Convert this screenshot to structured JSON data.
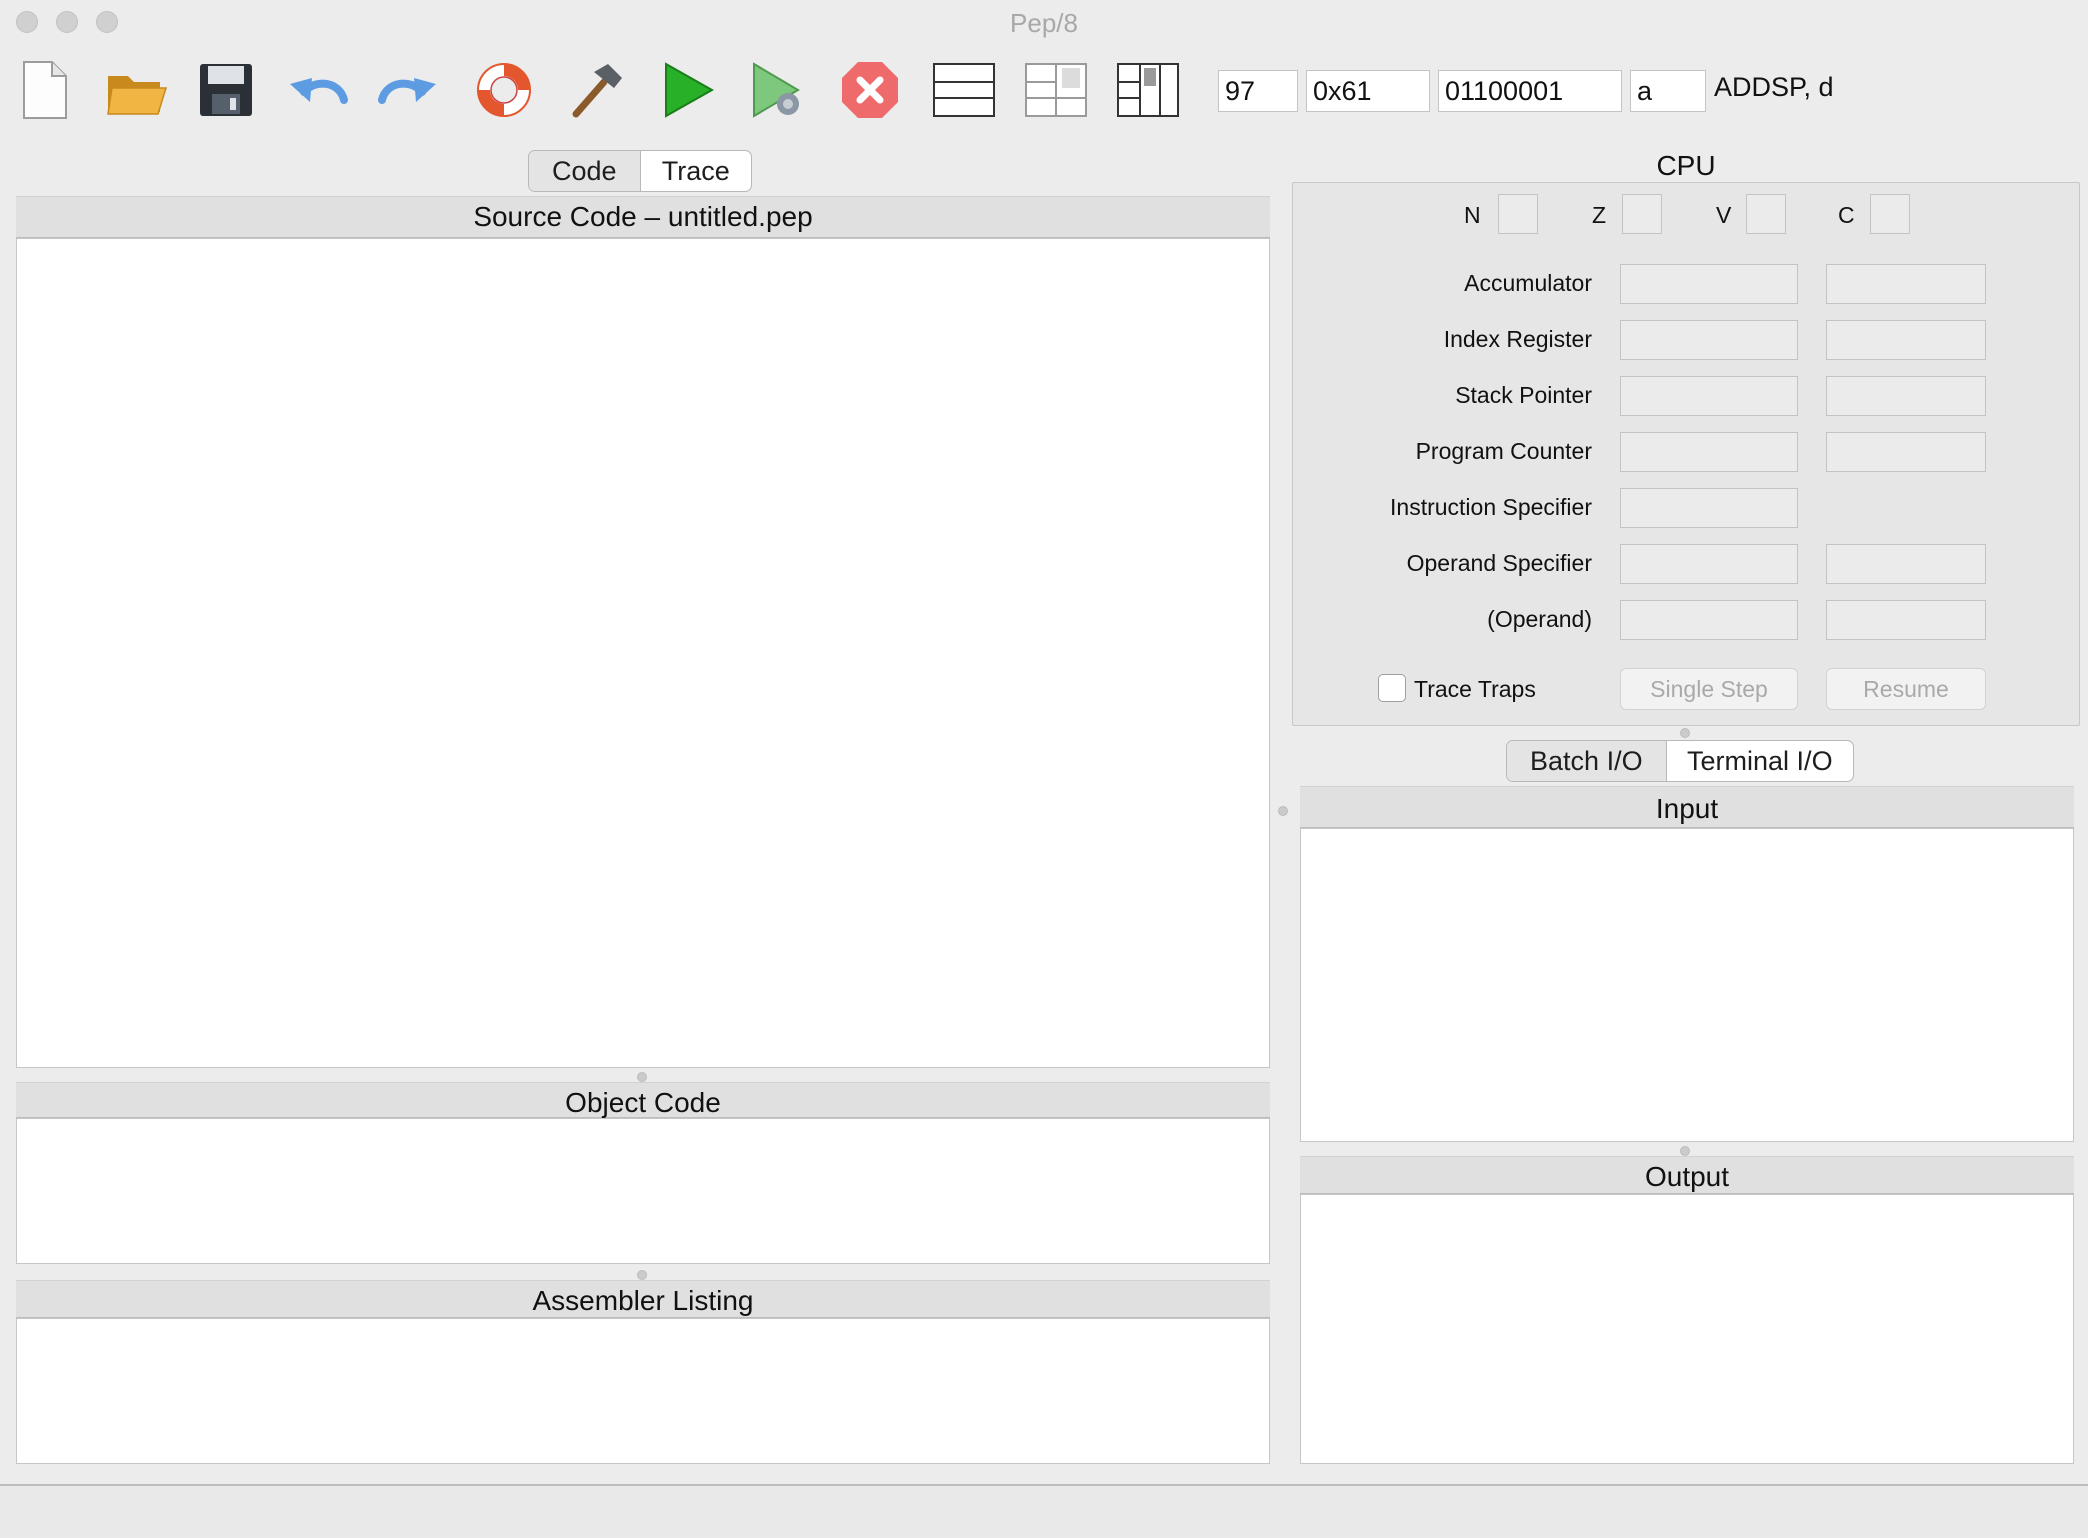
{
  "window": {
    "title": "Pep/8"
  },
  "toolbar": {
    "icons": [
      "new-file-icon",
      "open-folder-icon",
      "save-disk-icon",
      "undo-arrow-icon",
      "redo-arrow-icon",
      "help-lifebuoy-icon",
      "build-hammer-icon",
      "run-play-icon",
      "debug-play-icon",
      "stop-icon",
      "layout-code-only-icon",
      "layout-code-trace-icon",
      "layout-code-memory-icon"
    ],
    "converter": {
      "decimal": "97",
      "hex": "0x61",
      "binary": "01100001",
      "char": "a",
      "mnemonic": "ADDSP, d"
    }
  },
  "left_tabs": {
    "code": "Code",
    "trace": "Trace",
    "selected": "Code"
  },
  "panes": {
    "source": {
      "title": "Source Code – untitled.pep"
    },
    "object": {
      "title": "Object Code"
    },
    "listing": {
      "title": "Assembler Listing"
    }
  },
  "cpu": {
    "title": "CPU",
    "flags": {
      "n": "N",
      "z": "Z",
      "v": "V",
      "c": "C"
    },
    "registers": {
      "accumulator": "Accumulator",
      "index": "Index Register",
      "stack": "Stack Pointer",
      "pc": "Program Counter",
      "instr": "Instruction Specifier",
      "operand_spec": "Operand Specifier",
      "operand": "(Operand)"
    },
    "trace_traps": "Trace Traps",
    "single_step": "Single Step",
    "resume": "Resume"
  },
  "io_tabs": {
    "batch": "Batch I/O",
    "terminal": "Terminal I/O",
    "selected": "Batch I/O"
  },
  "io": {
    "input": "Input",
    "output": "Output"
  }
}
